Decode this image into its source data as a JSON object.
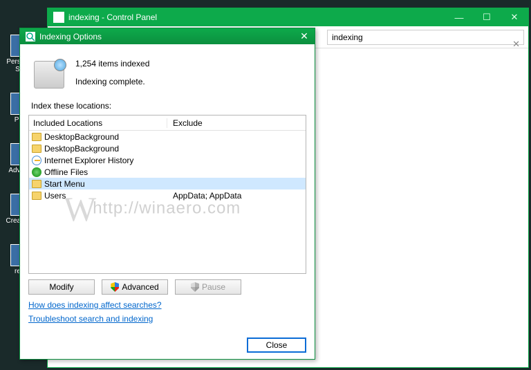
{
  "desktop": {
    "icons": [
      {
        "label": "Persona - Sho"
      },
      {
        "label": "Proc"
      },
      {
        "label": "Adva Au"
      },
      {
        "label": "Create Po"
      },
      {
        "label": "rege"
      }
    ]
  },
  "control_panel": {
    "title": "indexing - Control Panel",
    "search": {
      "value": "indexing",
      "clear": "✕"
    },
    "ctrls": {
      "min": "—",
      "max": "☐",
      "close": "✕"
    }
  },
  "dialog": {
    "title": "Indexing Options",
    "close_glyph": "✕",
    "status_line1": "1,254 items indexed",
    "status_line2": "Indexing complete.",
    "section_label": "Index these locations:",
    "headers": {
      "included": "Included Locations",
      "exclude": "Exclude"
    },
    "rows": [
      {
        "icon": "folder",
        "name": "DesktopBackground",
        "exclude": ""
      },
      {
        "icon": "folder",
        "name": "DesktopBackground",
        "exclude": ""
      },
      {
        "icon": "ie",
        "name": "Internet Explorer History",
        "exclude": ""
      },
      {
        "icon": "offline",
        "name": "Offline Files",
        "exclude": ""
      },
      {
        "icon": "folder",
        "name": "Start Menu",
        "exclude": "",
        "selected": true
      },
      {
        "icon": "folder",
        "name": "Users",
        "exclude": "AppData; AppData"
      }
    ],
    "buttons": {
      "modify": "Modify",
      "advanced": "Advanced",
      "pause": "Pause"
    },
    "links": {
      "help1": "How does indexing affect searches?",
      "help2": "Troubleshoot search and indexing"
    },
    "close_btn": "Close"
  },
  "watermark": "http://winaero.com"
}
